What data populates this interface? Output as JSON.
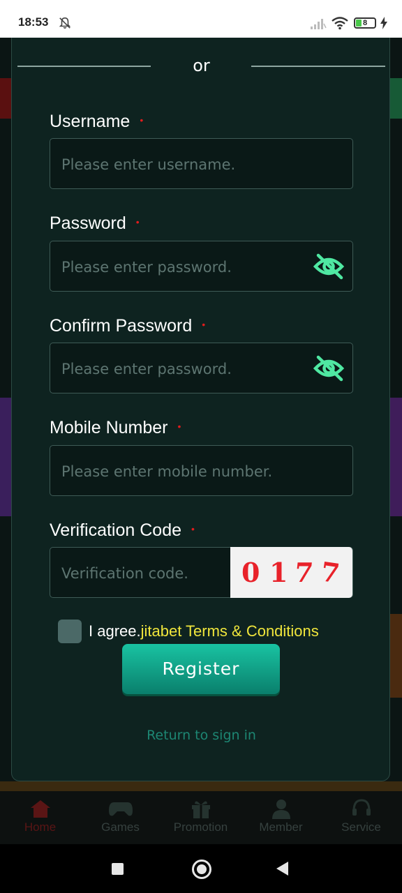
{
  "status": {
    "time": "18:53",
    "battery": "8"
  },
  "divider_text": "or",
  "form": {
    "username": {
      "label": "Username",
      "placeholder": "Please enter username."
    },
    "password": {
      "label": "Password",
      "placeholder": "Please enter password."
    },
    "confirm_password": {
      "label": "Confirm Password",
      "placeholder": "Please enter password."
    },
    "mobile": {
      "label": "Mobile Number",
      "placeholder": "Please enter mobile number."
    },
    "verification": {
      "label": "Verification Code",
      "placeholder": "Verification code.",
      "captcha": [
        "0",
        "1",
        "7",
        "7"
      ]
    },
    "required_mark": "•",
    "agree_prefix": "I agree.",
    "agree_link": "jitabet Terms & Conditions",
    "register_label": "Register",
    "return_link": "Return to sign in"
  },
  "bottom_nav": [
    {
      "label": "Home",
      "icon": "home-icon"
    },
    {
      "label": "Games",
      "icon": "gamepad-icon"
    },
    {
      "label": "Promotion",
      "icon": "gift-icon"
    },
    {
      "label": "Member",
      "icon": "person-icon"
    },
    {
      "label": "Service",
      "icon": "headset-icon"
    }
  ],
  "colors": {
    "modal_bg": "#0e2320",
    "accent": "#19c3a2",
    "link_yellow": "#f0e63c",
    "required_red": "#e01c1c",
    "eye_green": "#4fe8a2"
  }
}
